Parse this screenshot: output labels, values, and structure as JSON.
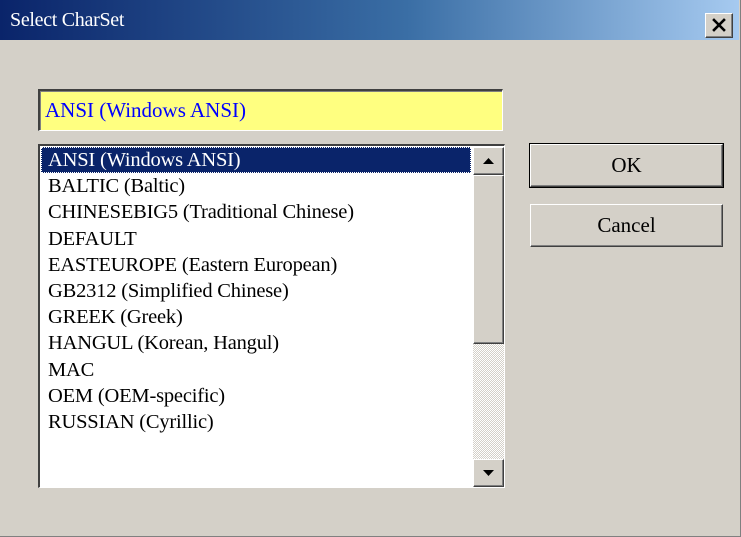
{
  "window": {
    "title": "Select CharSet"
  },
  "selected_field": {
    "value": "ANSI (Windows ANSI)"
  },
  "charset_list": {
    "items": [
      "ANSI (Windows ANSI)",
      "BALTIC (Baltic)",
      "CHINESEBIG5 (Traditional Chinese)",
      "DEFAULT",
      "EASTEUROPE (Eastern European)",
      "GB2312 (Simplified Chinese)",
      "GREEK (Greek)",
      "HANGUL (Korean, Hangul)",
      "MAC",
      "OEM (OEM-specific)",
      "RUSSIAN (Cyrillic)"
    ],
    "selected_index": 0
  },
  "buttons": {
    "ok": "OK",
    "cancel": "Cancel"
  },
  "colors": {
    "title_bar_start": "#0a246a",
    "title_bar_end": "#a6caf0",
    "selection": "#0a246a",
    "field_background": "#ffff80",
    "field_text": "#0000ff",
    "dialog_face": "#d4d0c8"
  },
  "icons": {
    "close": "close-icon",
    "scroll_up": "arrow-up-icon",
    "scroll_down": "arrow-down-icon"
  }
}
